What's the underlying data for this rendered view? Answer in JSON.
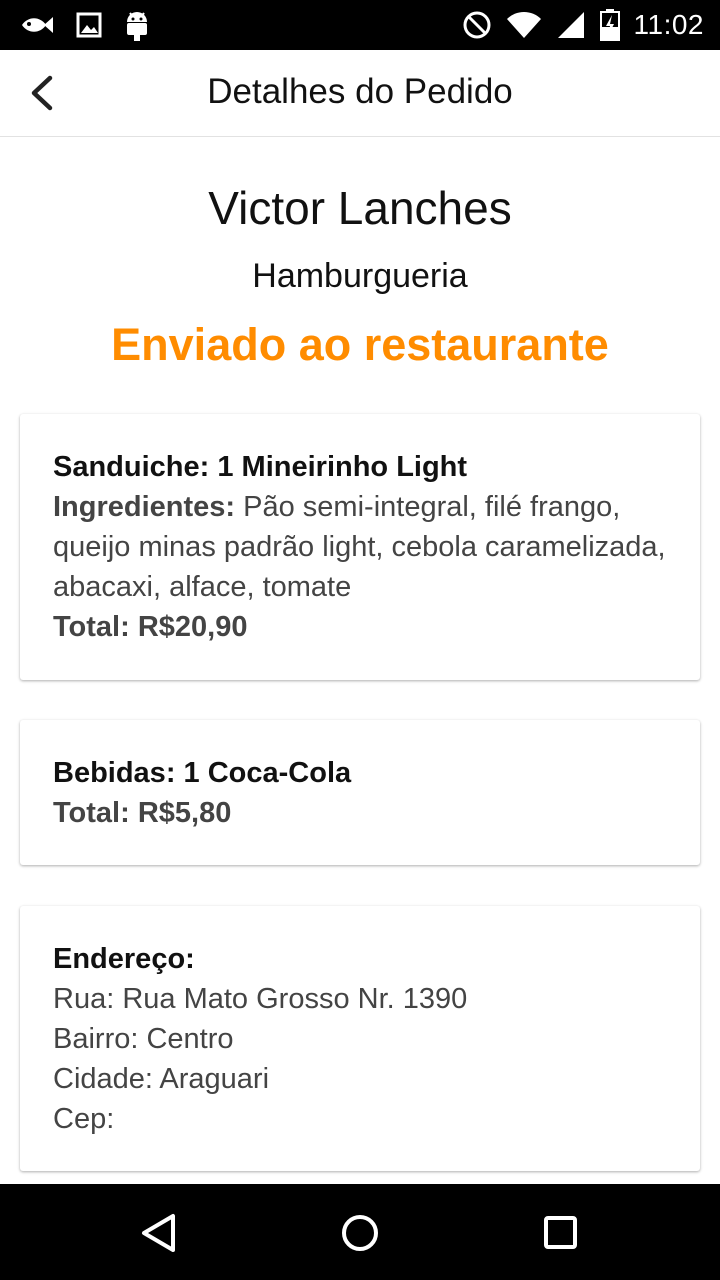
{
  "status_bar": {
    "time": "11:02",
    "left_icons": [
      "fish-icon",
      "image-icon",
      "android-icon"
    ],
    "right_icons": [
      "do-not-disturb-icon",
      "wifi-icon",
      "signal-icon",
      "battery-charging-icon"
    ]
  },
  "app_bar": {
    "title": "Detalhes do Pedido",
    "back_icon": "back-arrow-icon"
  },
  "restaurant": {
    "name": "Victor Lanches",
    "category": "Hamburgueria",
    "status": "Enviado ao restaurante",
    "status_color": "#ff8c00"
  },
  "sandwich_card": {
    "heading": "Sanduiche: 1 Mineirinho Light",
    "ingredients_label": "Ingredientes:",
    "ingredients": " Pão semi-integral, filé frango, queijo minas padrão light, cebola caramelizada, abacaxi, alface, tomate",
    "total": "Total: R$20,90"
  },
  "drinks_card": {
    "heading": "Bebidas: 1 Coca-Cola",
    "total": "Total: R$5,80"
  },
  "address_card": {
    "heading": "Endereço:",
    "street": "Rua: Rua Mato Grosso Nr. 1390",
    "neighborhood": "Bairro: Centro",
    "city": "Cidade: Araguari",
    "zip": "Cep:"
  },
  "nav_bar": {
    "icons": [
      "back-triangle-icon",
      "home-circle-icon",
      "recents-square-icon"
    ]
  }
}
